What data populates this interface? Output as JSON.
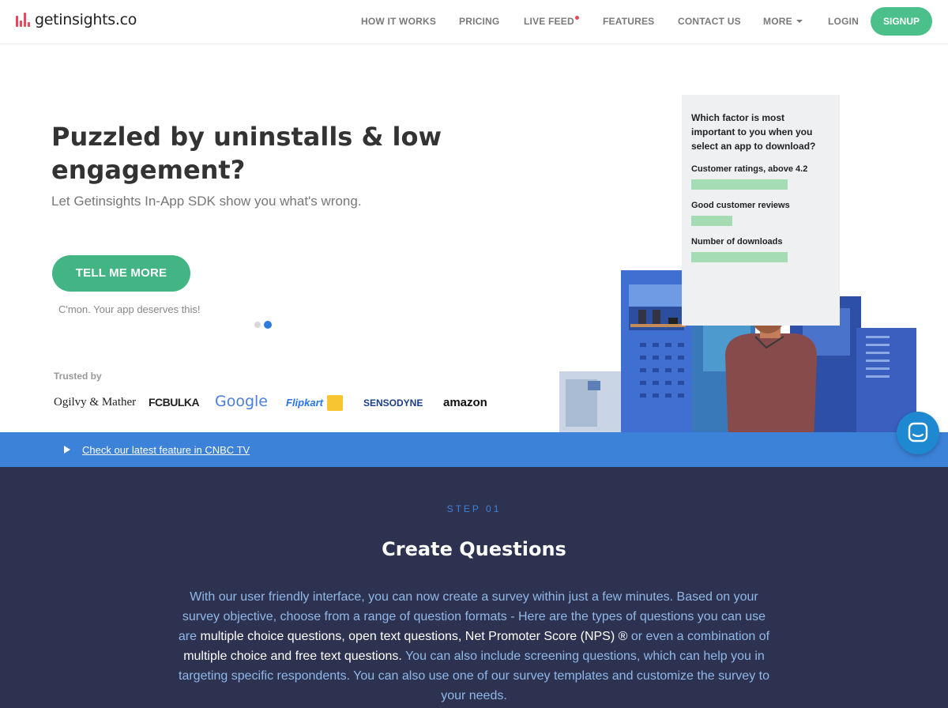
{
  "brand": {
    "name": "getinsights.co"
  },
  "nav": {
    "how_it_works": "HOW IT WORKS",
    "pricing": "PRICING",
    "live_feed": "LIVE FEED",
    "features": "FEATURES",
    "contact_us": "CONTACT US",
    "more": "MORE",
    "login": "LOGIN",
    "signup": "SIGNUP"
  },
  "hero": {
    "title": "Puzzled by uninstalls & low engagement?",
    "subtitle": "Let Getinsights In-App SDK show you what's wrong.",
    "cta": "TELL ME MORE",
    "cta_note": "C'mon. Your app deserves this!",
    "trusted_by": "Trusted by",
    "brands": [
      "Ogilvy & Mather",
      "FCBULKA",
      "Google",
      "Flipkart",
      "SENSODYNE",
      "amazon"
    ]
  },
  "survey_card": {
    "question": "Which factor is most important to you when you select an app to download?",
    "options": [
      {
        "label": "Customer ratings, above 4.2",
        "share": 1.0
      },
      {
        "label": "Good customer reviews",
        "share": 0.43
      },
      {
        "label": "Number of downloads",
        "share": 1.0
      }
    ]
  },
  "banner": {
    "link": "Check our latest feature in CNBC TV"
  },
  "step": {
    "label": "STEP 01",
    "title": "Create Questions",
    "p1": "With our user friendly interface, you can now create a survey within just a few minutes. Based on your survey objective, choose from a range of question formats - Here are the types of questions you can use are ",
    "h1": "multiple choice questions, open text questions, Net Promoter Score (NPS) ®",
    "p2": " or even a combination of ",
    "h2": "multiple choice and free text questions.",
    "p3": " You can also include screening questions, which can help you in targeting specific respondents. You can also use one of our survey templates and customize the survey to your needs."
  },
  "colors": {
    "accent_green": "#43b584",
    "brand_red": "#e8485c",
    "strip_blue": "#3c82d8",
    "dark_bg": "#2e3251"
  }
}
